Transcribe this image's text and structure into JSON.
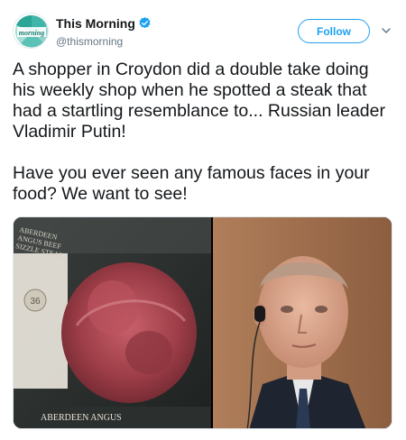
{
  "account": {
    "display_name": "This Morning",
    "handle": "@thismorning",
    "avatar_icon": "this-morning-logo-icon",
    "verified_icon": "verified-badge-icon"
  },
  "actions": {
    "follow_label": "Follow",
    "menu_icon": "chevron-down-icon"
  },
  "tweet": {
    "paragraphs": [
      "A shopper in Croydon did a double take doing his weekly shop when he spotted a steak that had a startling resemblance to... Russian leader Vladimir Putin!",
      "Have you ever seen any famous faces in your food? We want to see!"
    ]
  },
  "media": {
    "left_photo": {
      "label_top_lines": [
        "ABERDEEN",
        "ANGUS BEEF",
        "SIZZLE STEAKS"
      ],
      "badge_number": "36",
      "label_bottom": "ABERDEEN ANGUS"
    }
  },
  "colors": {
    "accent": "#1da1f2",
    "text": "#14171a",
    "secondary": "#657786",
    "border": "#e1e8ed"
  }
}
